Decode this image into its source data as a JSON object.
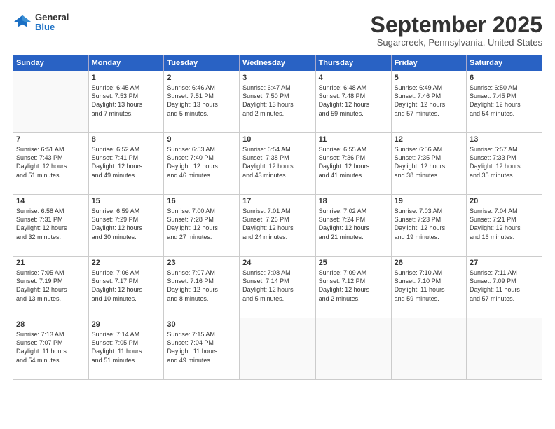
{
  "header": {
    "logo_general": "General",
    "logo_blue": "Blue",
    "month_title": "September 2025",
    "subtitle": "Sugarcreek, Pennsylvania, United States"
  },
  "weekdays": [
    "Sunday",
    "Monday",
    "Tuesday",
    "Wednesday",
    "Thursday",
    "Friday",
    "Saturday"
  ],
  "weeks": [
    [
      {
        "day": "",
        "info": ""
      },
      {
        "day": "1",
        "info": "Sunrise: 6:45 AM\nSunset: 7:53 PM\nDaylight: 13 hours\nand 7 minutes."
      },
      {
        "day": "2",
        "info": "Sunrise: 6:46 AM\nSunset: 7:51 PM\nDaylight: 13 hours\nand 5 minutes."
      },
      {
        "day": "3",
        "info": "Sunrise: 6:47 AM\nSunset: 7:50 PM\nDaylight: 13 hours\nand 2 minutes."
      },
      {
        "day": "4",
        "info": "Sunrise: 6:48 AM\nSunset: 7:48 PM\nDaylight: 12 hours\nand 59 minutes."
      },
      {
        "day": "5",
        "info": "Sunrise: 6:49 AM\nSunset: 7:46 PM\nDaylight: 12 hours\nand 57 minutes."
      },
      {
        "day": "6",
        "info": "Sunrise: 6:50 AM\nSunset: 7:45 PM\nDaylight: 12 hours\nand 54 minutes."
      }
    ],
    [
      {
        "day": "7",
        "info": "Sunrise: 6:51 AM\nSunset: 7:43 PM\nDaylight: 12 hours\nand 51 minutes."
      },
      {
        "day": "8",
        "info": "Sunrise: 6:52 AM\nSunset: 7:41 PM\nDaylight: 12 hours\nand 49 minutes."
      },
      {
        "day": "9",
        "info": "Sunrise: 6:53 AM\nSunset: 7:40 PM\nDaylight: 12 hours\nand 46 minutes."
      },
      {
        "day": "10",
        "info": "Sunrise: 6:54 AM\nSunset: 7:38 PM\nDaylight: 12 hours\nand 43 minutes."
      },
      {
        "day": "11",
        "info": "Sunrise: 6:55 AM\nSunset: 7:36 PM\nDaylight: 12 hours\nand 41 minutes."
      },
      {
        "day": "12",
        "info": "Sunrise: 6:56 AM\nSunset: 7:35 PM\nDaylight: 12 hours\nand 38 minutes."
      },
      {
        "day": "13",
        "info": "Sunrise: 6:57 AM\nSunset: 7:33 PM\nDaylight: 12 hours\nand 35 minutes."
      }
    ],
    [
      {
        "day": "14",
        "info": "Sunrise: 6:58 AM\nSunset: 7:31 PM\nDaylight: 12 hours\nand 32 minutes."
      },
      {
        "day": "15",
        "info": "Sunrise: 6:59 AM\nSunset: 7:29 PM\nDaylight: 12 hours\nand 30 minutes."
      },
      {
        "day": "16",
        "info": "Sunrise: 7:00 AM\nSunset: 7:28 PM\nDaylight: 12 hours\nand 27 minutes."
      },
      {
        "day": "17",
        "info": "Sunrise: 7:01 AM\nSunset: 7:26 PM\nDaylight: 12 hours\nand 24 minutes."
      },
      {
        "day": "18",
        "info": "Sunrise: 7:02 AM\nSunset: 7:24 PM\nDaylight: 12 hours\nand 21 minutes."
      },
      {
        "day": "19",
        "info": "Sunrise: 7:03 AM\nSunset: 7:23 PM\nDaylight: 12 hours\nand 19 minutes."
      },
      {
        "day": "20",
        "info": "Sunrise: 7:04 AM\nSunset: 7:21 PM\nDaylight: 12 hours\nand 16 minutes."
      }
    ],
    [
      {
        "day": "21",
        "info": "Sunrise: 7:05 AM\nSunset: 7:19 PM\nDaylight: 12 hours\nand 13 minutes."
      },
      {
        "day": "22",
        "info": "Sunrise: 7:06 AM\nSunset: 7:17 PM\nDaylight: 12 hours\nand 10 minutes."
      },
      {
        "day": "23",
        "info": "Sunrise: 7:07 AM\nSunset: 7:16 PM\nDaylight: 12 hours\nand 8 minutes."
      },
      {
        "day": "24",
        "info": "Sunrise: 7:08 AM\nSunset: 7:14 PM\nDaylight: 12 hours\nand 5 minutes."
      },
      {
        "day": "25",
        "info": "Sunrise: 7:09 AM\nSunset: 7:12 PM\nDaylight: 12 hours\nand 2 minutes."
      },
      {
        "day": "26",
        "info": "Sunrise: 7:10 AM\nSunset: 7:10 PM\nDaylight: 11 hours\nand 59 minutes."
      },
      {
        "day": "27",
        "info": "Sunrise: 7:11 AM\nSunset: 7:09 PM\nDaylight: 11 hours\nand 57 minutes."
      }
    ],
    [
      {
        "day": "28",
        "info": "Sunrise: 7:13 AM\nSunset: 7:07 PM\nDaylight: 11 hours\nand 54 minutes."
      },
      {
        "day": "29",
        "info": "Sunrise: 7:14 AM\nSunset: 7:05 PM\nDaylight: 11 hours\nand 51 minutes."
      },
      {
        "day": "30",
        "info": "Sunrise: 7:15 AM\nSunset: 7:04 PM\nDaylight: 11 hours\nand 49 minutes."
      },
      {
        "day": "",
        "info": ""
      },
      {
        "day": "",
        "info": ""
      },
      {
        "day": "",
        "info": ""
      },
      {
        "day": "",
        "info": ""
      }
    ]
  ]
}
